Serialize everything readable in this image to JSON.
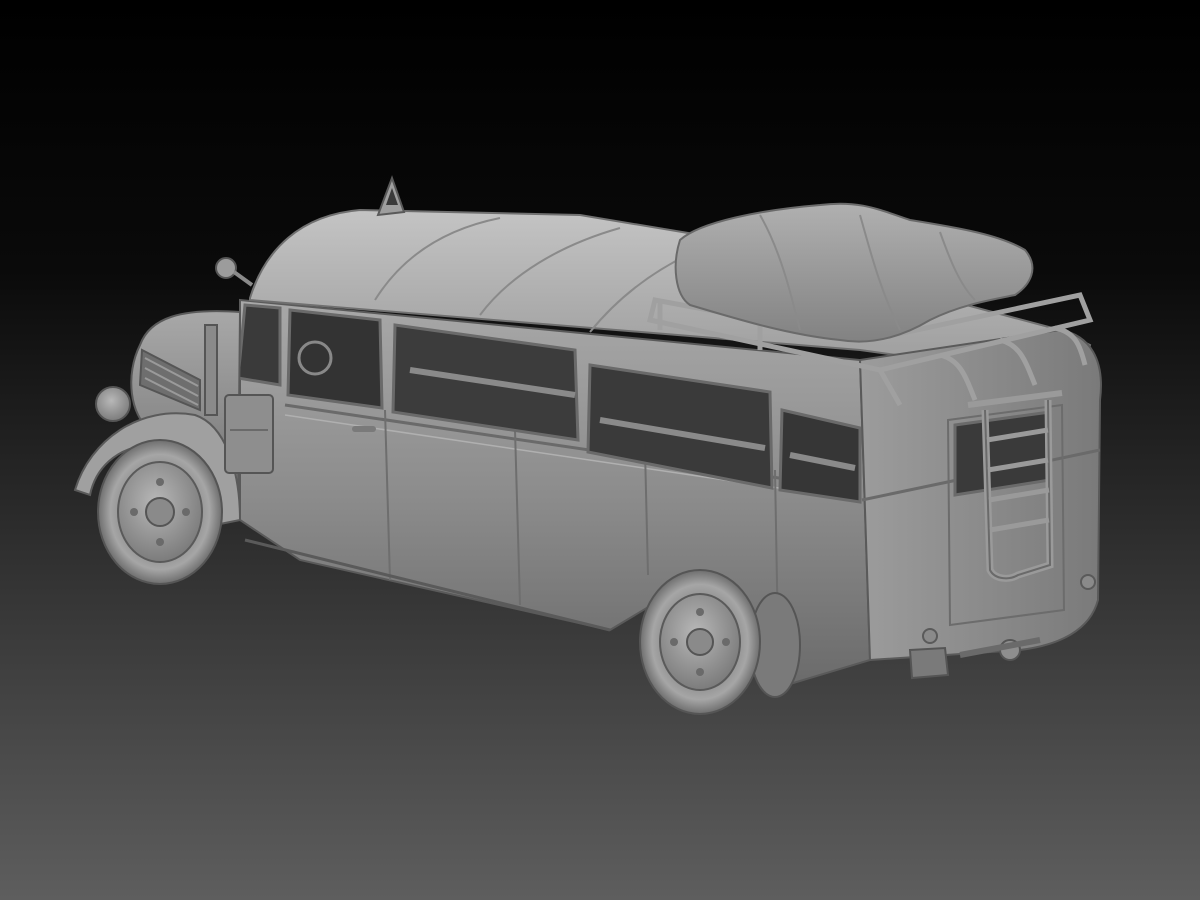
{
  "scene": {
    "subject": "vintage-bus-3d-render",
    "palette": {
      "background_top": "#000000",
      "background_bottom": "#5e5e5e",
      "clay_light": "#bdbdbd",
      "clay_mid": "#8f8f8f",
      "clay_dark": "#4a4a4a",
      "window_dark": "#2a2a2a"
    },
    "icons": [
      "roof-sign-triangle",
      "roof-rack",
      "rear-ladder",
      "tarp-luggage"
    ]
  }
}
